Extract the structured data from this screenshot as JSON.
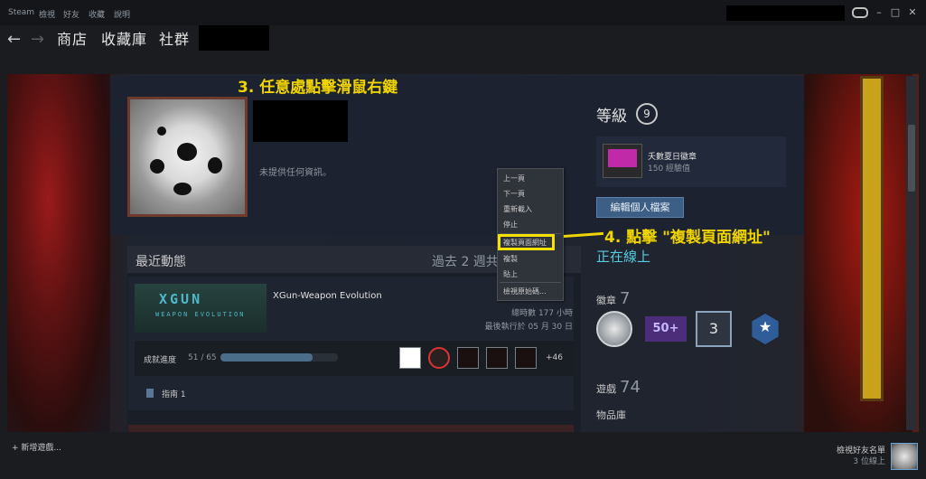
{
  "menubar": {
    "items": [
      "Steam",
      "檢視",
      "好友",
      "收藏",
      "說明"
    ]
  },
  "window_controls": {
    "minimize": "–",
    "maximize": "□",
    "close": "✕"
  },
  "nav": {
    "back": "←",
    "forward": "→",
    "links": [
      "商店",
      "收藏庫",
      "社群"
    ]
  },
  "profile": {
    "no_info": "未提供任何資訊。",
    "level_label": "等級",
    "level": "9",
    "badge_name": "夭數夏日徽章",
    "badge_xp": "150 經驗值",
    "edit_button": "編輯個人檔案",
    "online_status": "正在線上"
  },
  "sidebar": {
    "badges_label": "徽章",
    "badges_count": "7",
    "badge_50": "50+",
    "badge_3": "3",
    "games_label": "遊戲",
    "games_count": "74",
    "inventory": "物品庫"
  },
  "recent": {
    "title": "最近動態",
    "hours": "過去 2 週共 4 小時",
    "game": {
      "name": "XGun-Weapon Evolution",
      "logo": "XGUN",
      "logo_sub": "WEAPON EVOLUTION",
      "total_hours": "總時數 177 小時",
      "last_played": "最後執行於 05 月 30 日",
      "achievements_label": "成就進度",
      "achievements_count": "51 / 65",
      "achievements_progress": 0.7846,
      "achievements_more": "+46",
      "guide": "指南 1"
    }
  },
  "context_menu": {
    "items": [
      "上一頁",
      "下一頁",
      "重新載入",
      "停止",
      "複製頁面網址",
      "複製",
      "貼上",
      "檢視原始碼..."
    ]
  },
  "annotations": {
    "step3": "3. 任意處點擊滑鼠右鍵",
    "step4": "4. 點擊 \"複製頁面網址\""
  },
  "bottom": {
    "add_game": "+  新增遊戲...",
    "friends_list": "檢視好友名單",
    "friends_online": "3 位線上"
  },
  "colors": {
    "accent_online": "#57cbde",
    "annotation": "#f0d400",
    "edit_button": "#3d5f85"
  }
}
